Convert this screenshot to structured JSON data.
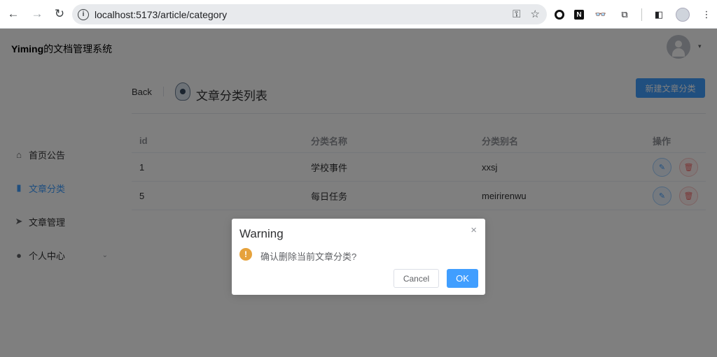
{
  "browser": {
    "url": "localhost:5173/article/category",
    "back_icon": "←",
    "forward_icon": "→",
    "reload_icon": "↻",
    "key_icon": "⚿",
    "star_icon": "☆",
    "ext_n": "N",
    "ext_mask": "👓",
    "puzzle_icon": "⧉",
    "sidepanel_icon": "◧",
    "menu_icon": "⋮"
  },
  "header": {
    "title_bold": "Yiming",
    "title_suffix": "的文档管理系统",
    "caret": "▾"
  },
  "sidebar": {
    "items": [
      {
        "label": "首页公告",
        "icon": "⌂"
      },
      {
        "label": "文章分类",
        "icon": "▮"
      },
      {
        "label": "文章管理",
        "icon": "➤"
      },
      {
        "label": "个人中心",
        "icon": "●",
        "chevron": "⌄"
      }
    ]
  },
  "main": {
    "back_label": "Back",
    "title": "文章分类列表",
    "new_button": "新建文章分类",
    "table": {
      "headers": [
        "id",
        "分类名称",
        "分类别名",
        "操作"
      ],
      "rows": [
        {
          "id": "1",
          "name": "学校事件",
          "alias": "xxsj"
        },
        {
          "id": "5",
          "name": "每日任务",
          "alias": "meirirenwu"
        }
      ],
      "edit_icon": "✎",
      "delete_icon": "🗑"
    }
  },
  "dialog": {
    "title": "Warning",
    "close": "×",
    "icon": "!",
    "message": "确认删除当前文章分类?",
    "cancel_label": "Cancel",
    "ok_label": "OK"
  }
}
